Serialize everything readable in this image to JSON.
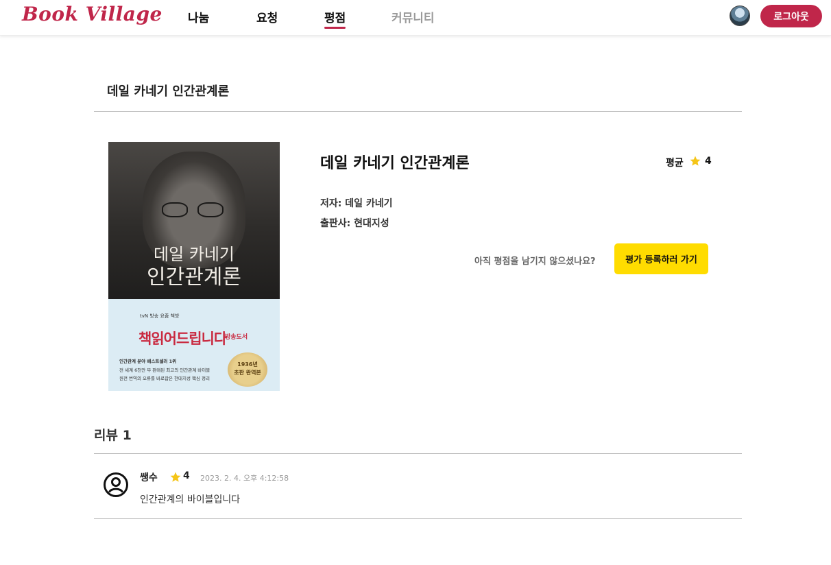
{
  "header": {
    "logo": "Book Village",
    "nav": [
      "나눔",
      "요청",
      "평점",
      "커뮤니티"
    ],
    "active_nav": "평점",
    "logout_label": "로그아웃"
  },
  "page": {
    "title": "데일 카네기 인간관계론"
  },
  "book": {
    "title": "데일 카네기 인간관계론",
    "average_label": "평균",
    "average_rating": "4",
    "author_label": "저자: 데일 카네기",
    "publisher_label": "출판사: 현대지성",
    "no_review_prompt": "아직 평점을 남기지 않으셨나요?",
    "review_button": "평가 등록하러 가기",
    "cover": {
      "title_line1": "데일 카네기",
      "title_line2": "인간관계론",
      "band_small": "tvN 방송 요즘 책방",
      "band_title": "책읽어드립니다",
      "band_tag": "방송도서",
      "band_line1": "인간관계 분야 베스트셀러 1위",
      "band_line2": "전 세계 6천만 부 판매된 최고의 인간관계 바이블",
      "band_line3": "원전 번역의 오류를 바로잡은 현대지성 핵심 정리",
      "seal_line1": "1936년",
      "seal_line2": "초판 완역본"
    }
  },
  "reviews": {
    "heading": "리뷰 1",
    "items": [
      {
        "user": "쌩수",
        "rating": "4",
        "date": "2023. 2. 4. 오후 4:12:58",
        "text": "인간관계의 바이블입니다"
      }
    ]
  },
  "colors": {
    "brand": "#c0264a",
    "star": "#f5c518",
    "cta": "#ffdc00"
  }
}
